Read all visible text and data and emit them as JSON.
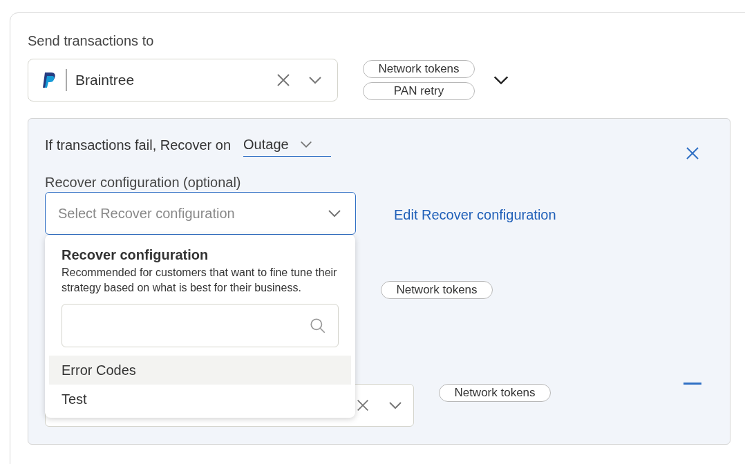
{
  "send_section": {
    "label": "Send transactions to",
    "processor": {
      "value": "Braintree"
    },
    "chips": [
      "Network tokens",
      "PAN retry"
    ]
  },
  "fallback_panel": {
    "title": "If transactions fail, Recover on",
    "trigger": {
      "value": "Outage"
    },
    "config_label": "Recover configuration (optional)",
    "config_select": {
      "placeholder": "Select Recover configuration"
    },
    "edit_link": "Edit Recover configuration",
    "rows": [
      {
        "chip": "Network tokens"
      },
      {
        "chip": "Network tokens"
      }
    ],
    "dropdown": {
      "title": "Recover configuration",
      "description": "Recommended for customers that want to fine tune their strategy based on what is best for their business.",
      "options": [
        {
          "label": "Error Codes",
          "selected": true
        },
        {
          "label": "Test",
          "selected": false
        }
      ]
    }
  }
}
